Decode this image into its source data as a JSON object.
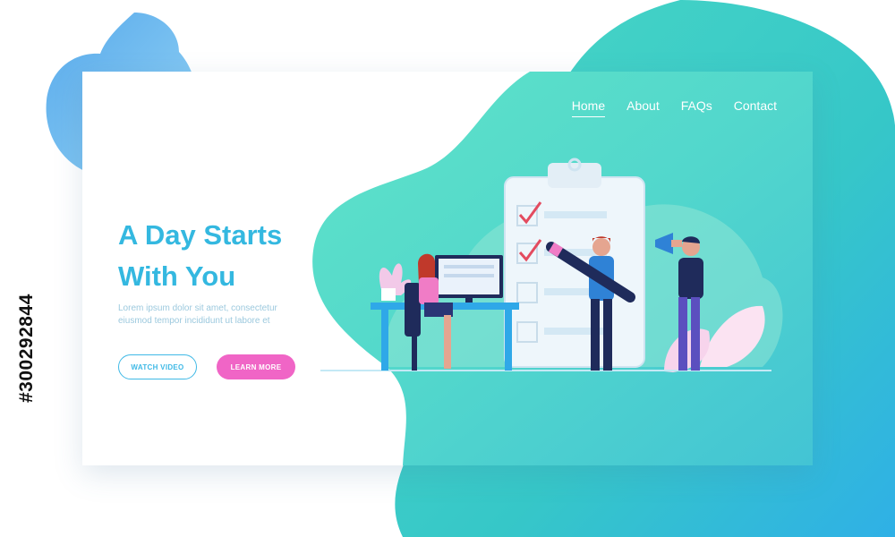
{
  "nav": {
    "items": [
      {
        "label": "Home",
        "active": true
      },
      {
        "label": "About",
        "active": false
      },
      {
        "label": "FAQs",
        "active": false
      },
      {
        "label": "Contact",
        "active": false
      }
    ]
  },
  "hero": {
    "title_line1": "A Day Starts",
    "title_line2": "With You",
    "body": "Lorem ipsum dolor sit amet, consectetur eiusmod tempor incididunt ut labore et"
  },
  "buttons": {
    "watch_video": "WATCH VIDEO",
    "learn_more": "LEARN MORE"
  },
  "stock": {
    "id": "#300292844"
  },
  "colors": {
    "accent_blue": "#34b8e0",
    "accent_pink": "#f065c6",
    "blob_teal": "#38d6c6",
    "blob_blue": "#5aa8ec"
  }
}
